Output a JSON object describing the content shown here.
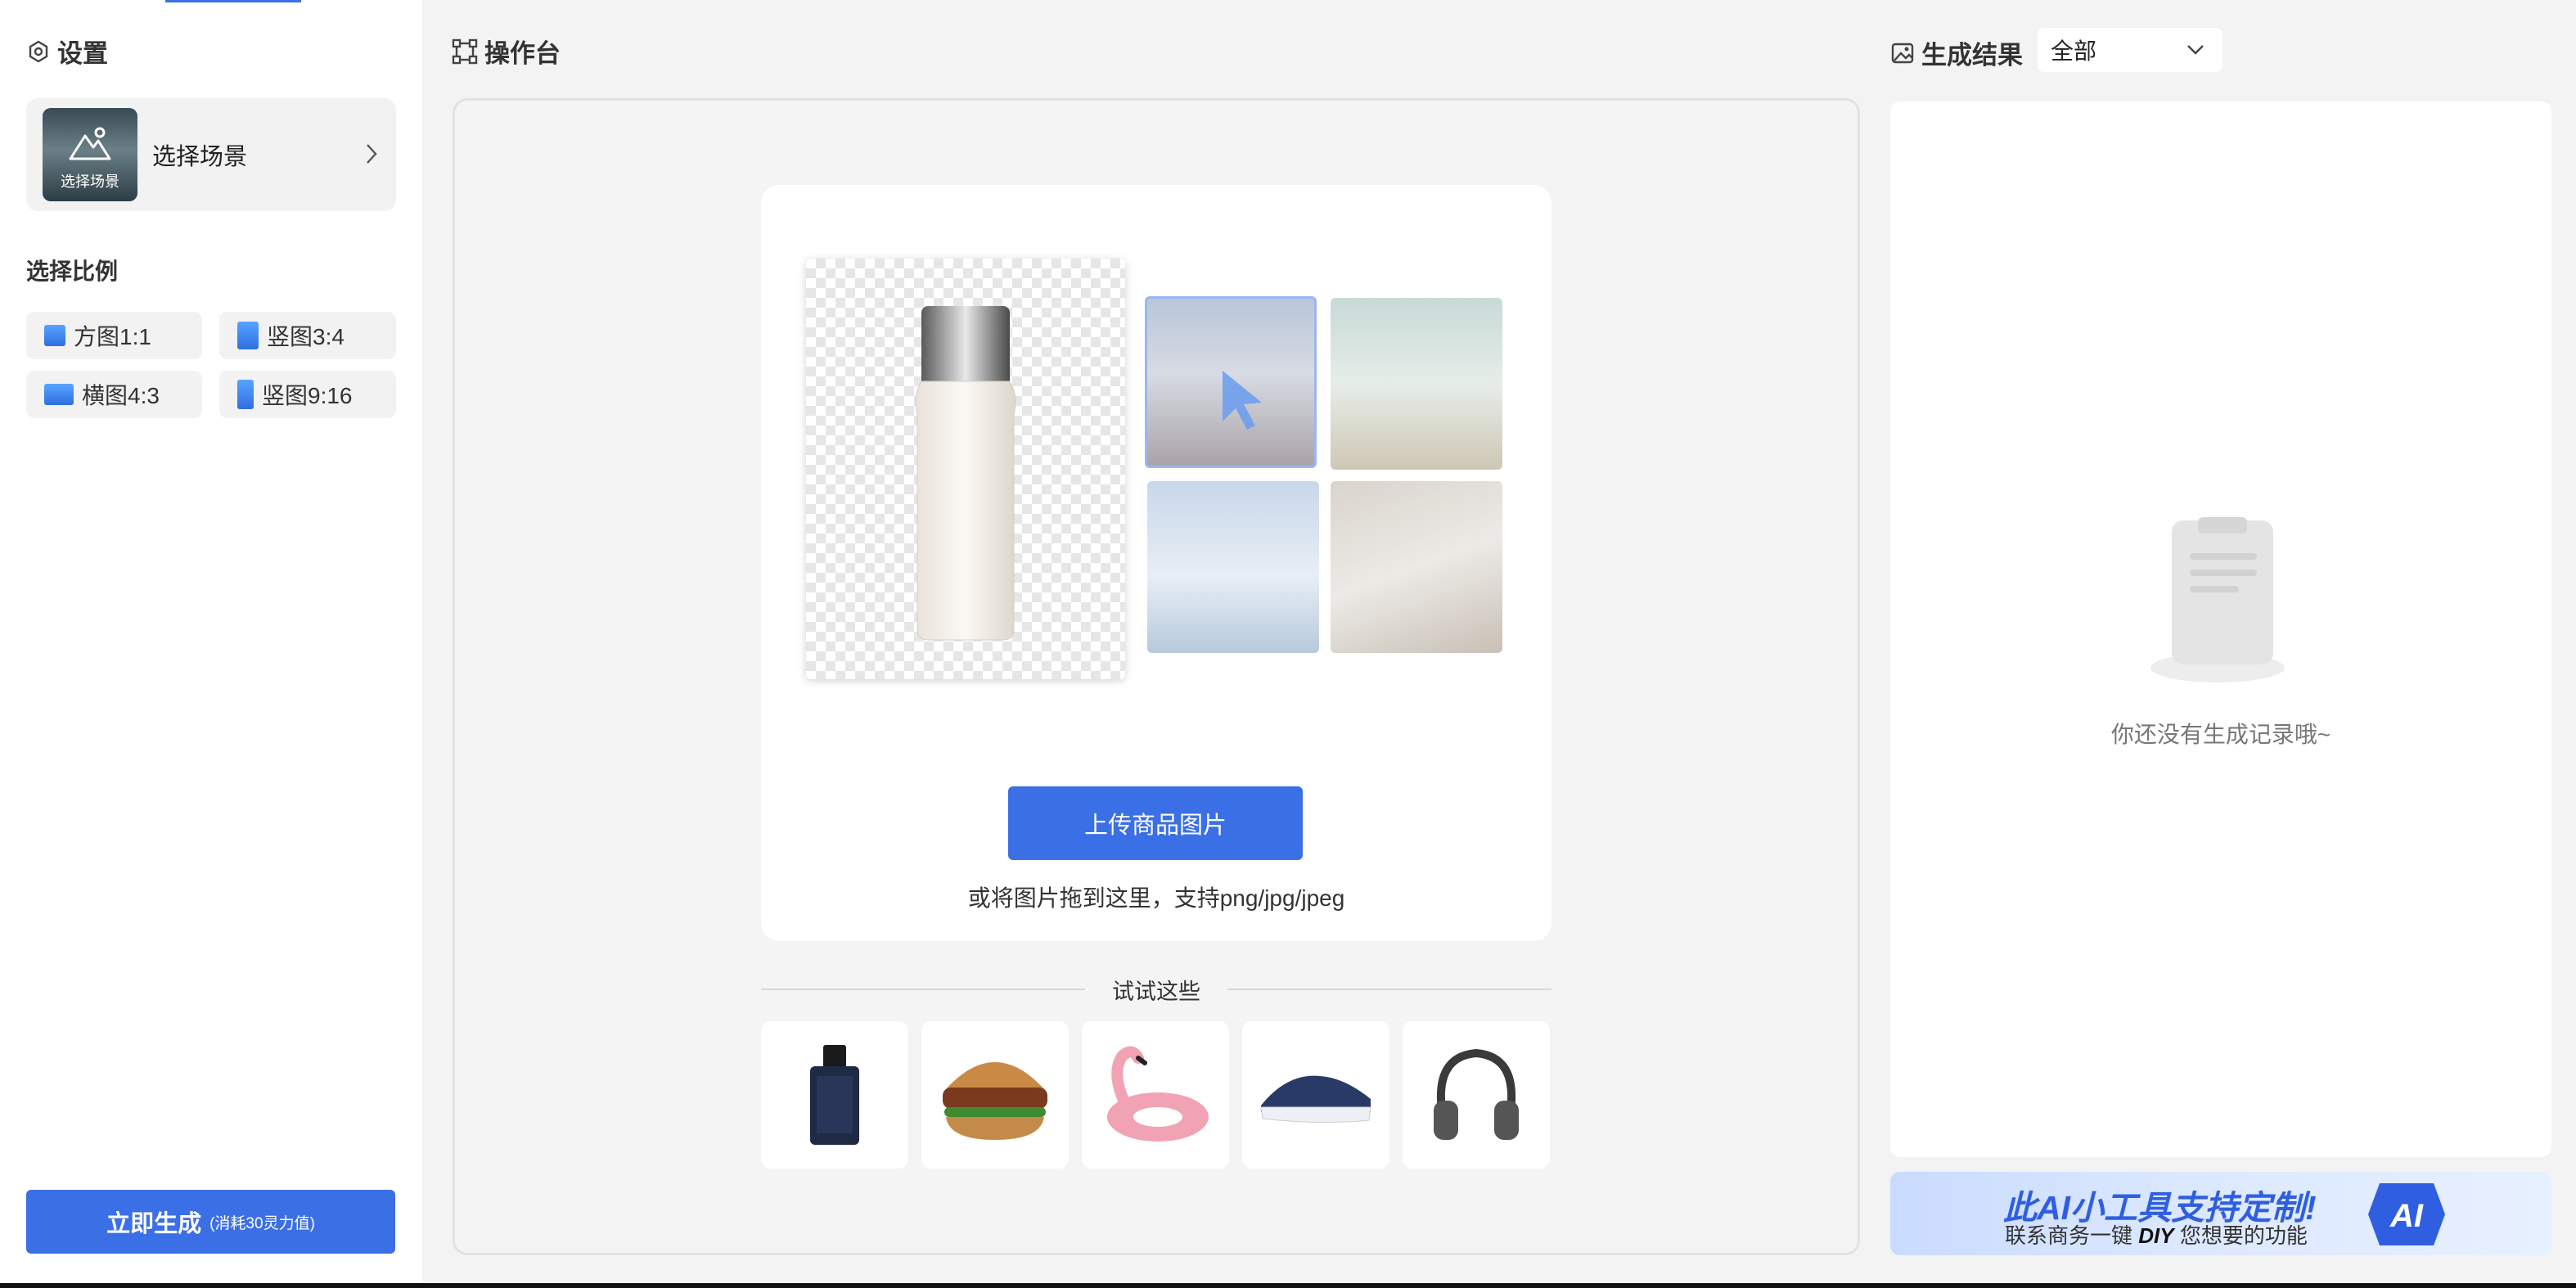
{
  "settings": {
    "title": "设置",
    "scene": {
      "thumb_caption": "选择场景",
      "label": "选择场景"
    },
    "ratio_title": "选择比例",
    "ratios": [
      {
        "label": "方图1:1"
      },
      {
        "label": "竖图3:4"
      },
      {
        "label": "横图4:3"
      },
      {
        "label": "竖图9:16"
      }
    ],
    "generate": {
      "label": "立即生成",
      "cost": "(消耗30灵力值)"
    }
  },
  "workbench": {
    "title": "操作台",
    "upload_label": "上传商品图片",
    "hint": "或将图片拖到这里，支持png/jpg/jpeg",
    "try_label": "试试这些",
    "samples": [
      {
        "icon": "perfume-bottle-icon"
      },
      {
        "icon": "burger-icon"
      },
      {
        "icon": "flamingo-float-icon"
      },
      {
        "icon": "sneaker-icon"
      },
      {
        "icon": "headphones-icon"
      }
    ]
  },
  "results": {
    "title": "生成结果",
    "filter": "全部",
    "empty_text": "你还没有生成记录哦~",
    "banner": {
      "title": "此AI小工具支持定制!",
      "sub_prefix": "联系商务一键",
      "sub_emph": "DIY",
      "sub_suffix": "您想要的功能",
      "badge": "AI"
    }
  },
  "colors": {
    "accent": "#3b6fe6",
    "panel_bg": "#f3f3f3"
  }
}
